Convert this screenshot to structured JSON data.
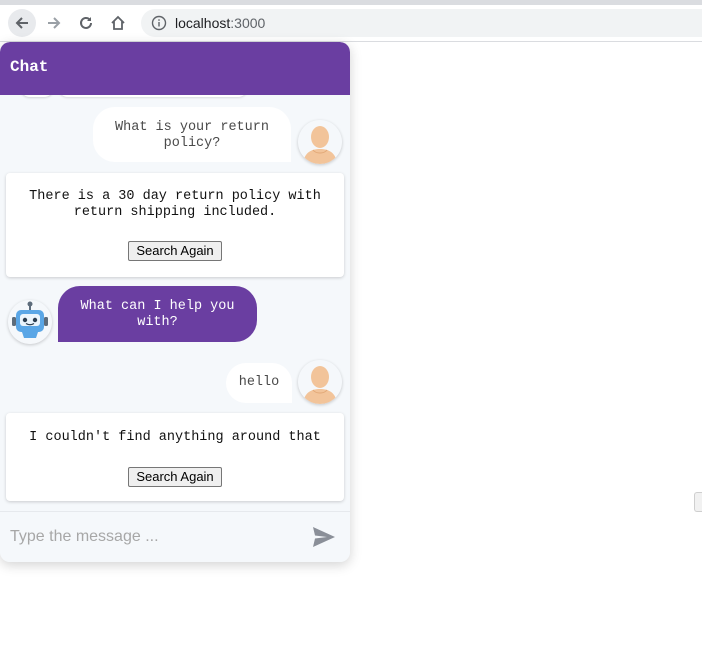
{
  "browser": {
    "url_host": "localhost",
    "url_port": ":3000"
  },
  "chat": {
    "title": "Chat",
    "messages": [
      {
        "sender": "user",
        "text": "What is your return policy?"
      },
      {
        "sender": "bot",
        "text": "There is a 30 day return policy with return shipping included.",
        "button": "Search Again"
      },
      {
        "sender": "bot",
        "text": "What can I help you with?"
      },
      {
        "sender": "user",
        "text": "hello"
      },
      {
        "sender": "bot",
        "text": "I couldn't find anything around that",
        "button": "Search Again"
      }
    ],
    "input": {
      "placeholder": "Type the message ..."
    }
  },
  "colors": {
    "header": "#6a3ea1",
    "bot_bubble": "#6a3ea1",
    "chat_background": "#f5f8fb"
  },
  "icons": [
    "back-arrow-icon",
    "forward-arrow-icon",
    "reload-icon",
    "home-icon",
    "info-icon",
    "user-avatar-icon",
    "robot-avatar-icon",
    "send-icon"
  ]
}
